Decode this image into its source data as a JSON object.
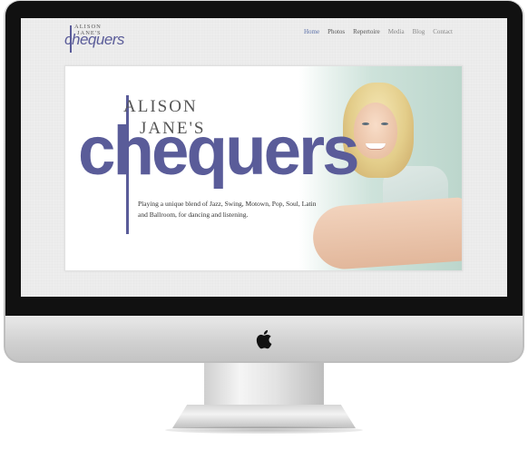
{
  "site": {
    "logo_top": "ALISON",
    "logo_top2": "JANE'S",
    "logo_main": "chequers"
  },
  "nav": {
    "items": [
      {
        "label": "Home",
        "state": "active"
      },
      {
        "label": "Photos",
        "state": "dark"
      },
      {
        "label": "Repertoire",
        "state": "dark"
      },
      {
        "label": "Media",
        "state": "normal"
      },
      {
        "label": "Blog",
        "state": "normal"
      },
      {
        "label": "Contact",
        "state": "normal"
      }
    ]
  },
  "hero": {
    "line1": "ALISON",
    "line2": "JANE'S",
    "main": "chequers",
    "tagline": "Playing a unique blend of Jazz, Swing, Motown, Pop, Soul, Latin and Ballroom, for dancing and listening."
  },
  "colors": {
    "brand": "#5a5c99",
    "nav_active": "#5a6fa8"
  }
}
